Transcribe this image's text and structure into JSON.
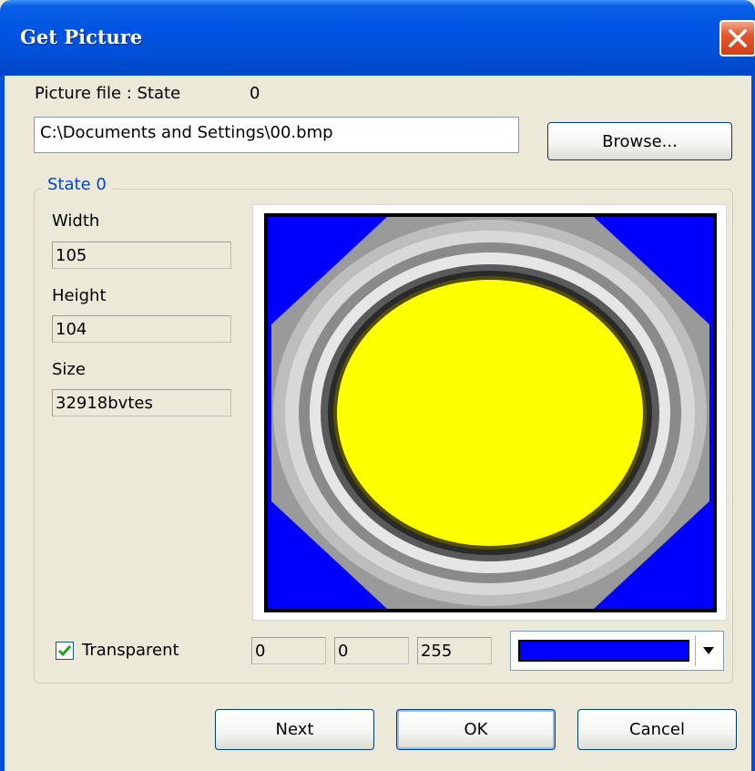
{
  "window": {
    "title": "Get Picture"
  },
  "picture_file": {
    "label": "Picture file : State",
    "state_value": "0",
    "path": "C:\\Documents and Settings\\00.bmp",
    "browse_label": "Browse..."
  },
  "group": {
    "title": "State 0"
  },
  "info": {
    "width_label": "Width",
    "width_value": "105",
    "height_label": "Height",
    "height_value": "104",
    "size_label": "Size",
    "size_value": "32918bvtes"
  },
  "transparent": {
    "label": "Transparent",
    "checked": true,
    "r": "0",
    "g": "0",
    "b": "255",
    "color": "#0000ff"
  },
  "buttons": {
    "next": "Next",
    "ok": "OK",
    "cancel": "Cancel"
  },
  "colors": {
    "title_bar": "#0054e3",
    "dialog_bg": "#ece9d8",
    "accent_text": "#0046d5",
    "preview_bg": "#0000ff",
    "preview_fill": "#ffff00"
  }
}
